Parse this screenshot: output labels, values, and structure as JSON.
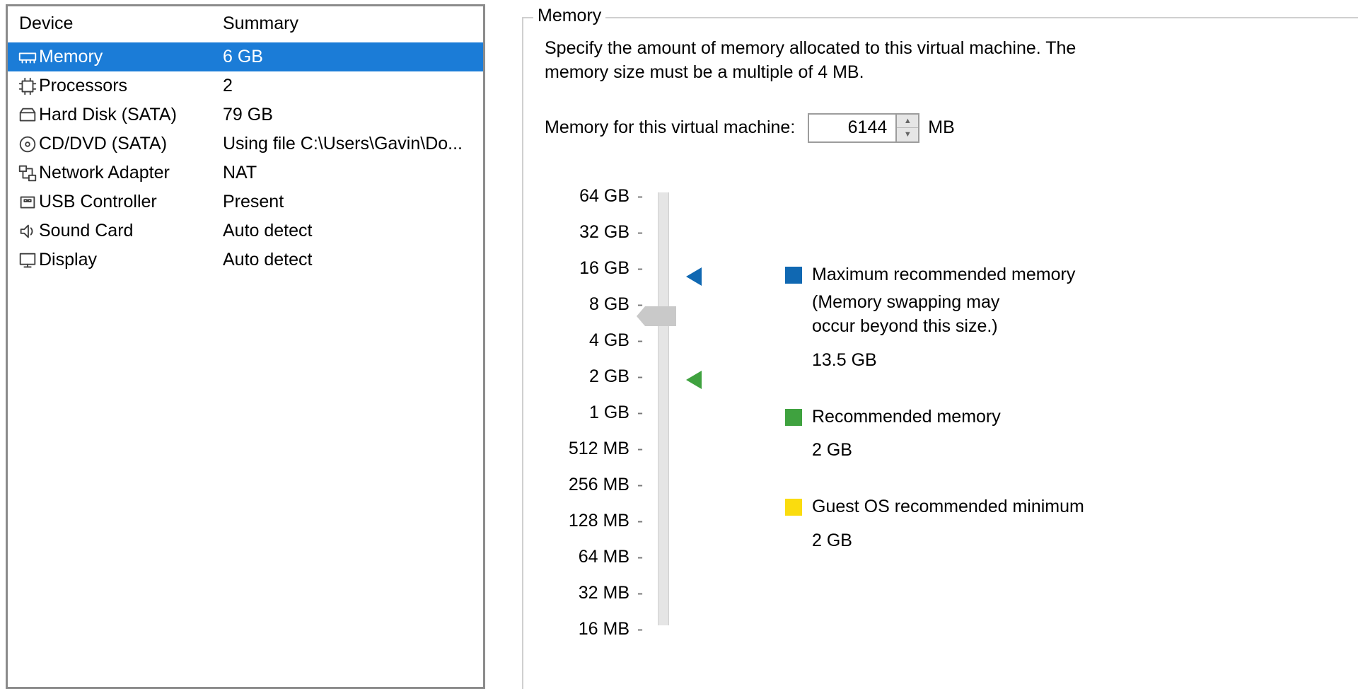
{
  "devicePanel": {
    "header": {
      "device": "Device",
      "summary": "Summary"
    },
    "items": [
      {
        "name": "Memory",
        "summary": "6 GB",
        "selected": true,
        "icon": "memory"
      },
      {
        "name": "Processors",
        "summary": "2",
        "selected": false,
        "icon": "cpu"
      },
      {
        "name": "Hard Disk (SATA)",
        "summary": "79 GB",
        "selected": false,
        "icon": "disk"
      },
      {
        "name": "CD/DVD (SATA)",
        "summary": "Using file C:\\Users\\Gavin\\Do...",
        "selected": false,
        "icon": "cd"
      },
      {
        "name": "Network Adapter",
        "summary": "NAT",
        "selected": false,
        "icon": "network"
      },
      {
        "name": "USB Controller",
        "summary": "Present",
        "selected": false,
        "icon": "usb"
      },
      {
        "name": "Sound Card",
        "summary": "Auto detect",
        "selected": false,
        "icon": "sound"
      },
      {
        "name": "Display",
        "summary": "Auto detect",
        "selected": false,
        "icon": "display"
      }
    ]
  },
  "memoryPanel": {
    "title": "Memory",
    "description": "Specify the amount of memory allocated to this virtual machine. The memory size must be a multiple of 4 MB.",
    "inputLabel": "Memory for this virtual machine:",
    "inputValue": "6144",
    "unit": "MB",
    "ticks": [
      "64 GB",
      "32 GB",
      "16 GB",
      "8 GB",
      "4 GB",
      "2 GB",
      "1 GB",
      "512 MB",
      "256 MB",
      "128 MB",
      "64 MB",
      "32 MB",
      "16 MB"
    ],
    "thumbIndex": 3.35,
    "markers": {
      "blueIndex": 2.25,
      "greenIndex": 5.1
    },
    "legend": {
      "max": {
        "title": "Maximum recommended memory",
        "sub1": "(Memory swapping may",
        "sub2": "occur beyond this size.)",
        "value": "13.5 GB"
      },
      "rec": {
        "title": "Recommended memory",
        "value": "2 GB"
      },
      "min": {
        "title": "Guest OS recommended minimum",
        "value": "2 GB"
      }
    }
  }
}
